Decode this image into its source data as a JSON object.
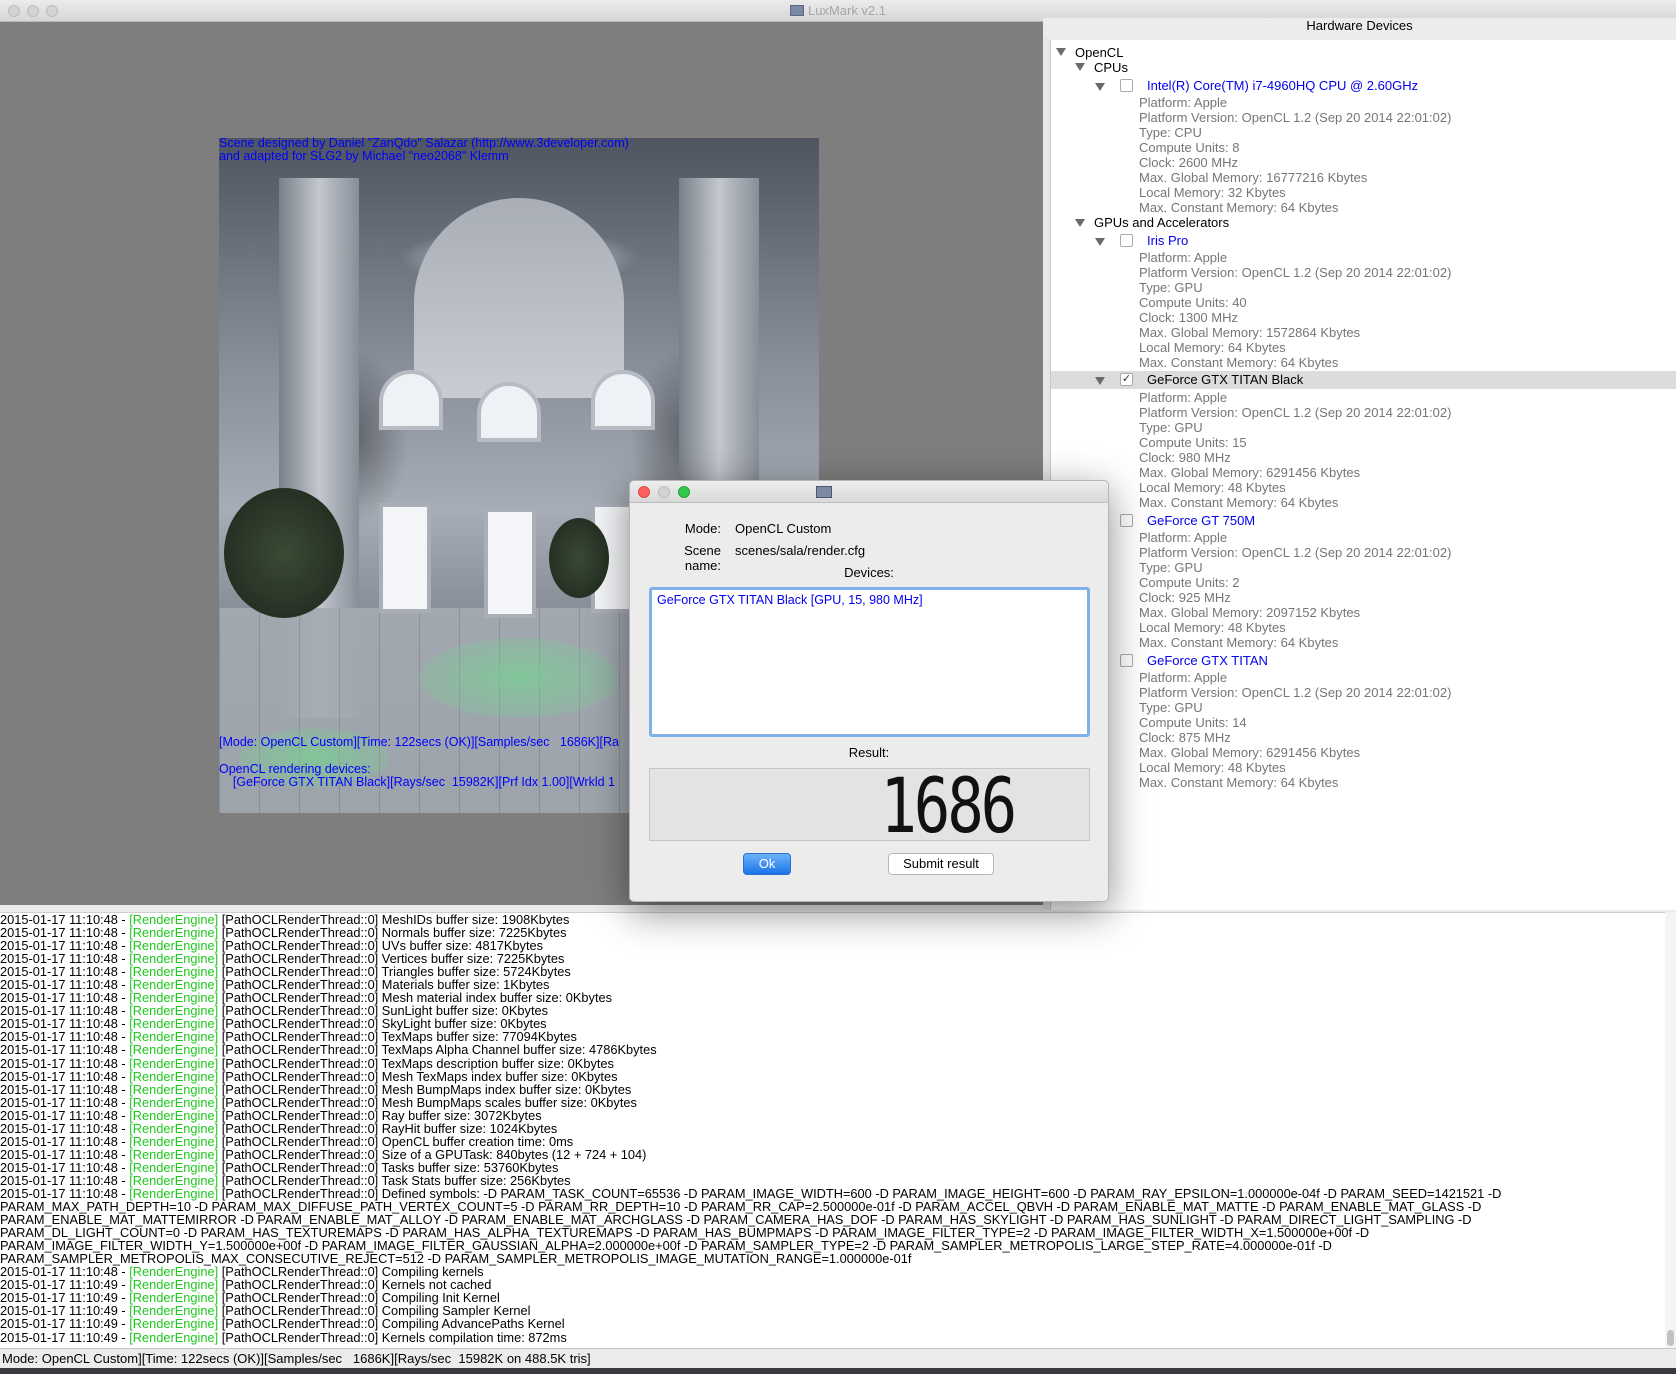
{
  "window": {
    "title": "LuxMark v2.1"
  },
  "render": {
    "credit_line1": "Scene designed by Daniel \"ZanQdo\" Salazar (http://www.3developer.com)",
    "credit_line2": "and adapted for SLG2 by Michael \"neo2068\" Klemm",
    "stats_line": "[Mode: OpenCL Custom][Time: 122secs (OK)][Samples/sec   1686K][Ra",
    "devices_label": "OpenCL rendering devices:",
    "device_line": "    [GeForce GTX TITAN Black][Rays/sec  15982K][Prf Idx 1.00][Wrkld 1"
  },
  "hardware": {
    "header": "Hardware Devices",
    "root": "OpenCL",
    "cpus_label": "CPUs",
    "gpus_label": "GPUs and Accelerators",
    "cpu": {
      "name": "Intel(R) Core(TM) i7-4960HQ CPU @ 2.60GHz",
      "props": [
        "Platform: Apple",
        "Platform Version: OpenCL 1.2 (Sep 20 2014 22:01:02)",
        "Type: CPU",
        "Compute Units: 8",
        "Clock: 2600 MHz",
        "Max. Global Memory: 16777216 Kbytes",
        "Local Memory: 32 Kbytes",
        "Max. Constant Memory: 64 Kbytes"
      ]
    },
    "gpu1": {
      "name": "Iris Pro",
      "props": [
        "Platform: Apple",
        "Platform Version: OpenCL 1.2 (Sep 20 2014 22:01:02)",
        "Type: GPU",
        "Compute Units: 40",
        "Clock: 1300 MHz",
        "Max. Global Memory: 1572864 Kbytes",
        "Local Memory: 64 Kbytes",
        "Max. Constant Memory: 64 Kbytes"
      ]
    },
    "gpu2": {
      "name": "GeForce GTX TITAN Black",
      "check": "✓",
      "props": [
        "Platform: Apple",
        "Platform Version: OpenCL 1.2 (Sep 20 2014 22:01:02)",
        "Type: GPU",
        "Compute Units: 15",
        "Clock: 980 MHz",
        "Max. Global Memory: 6291456 Kbytes",
        "Local Memory: 48 Kbytes",
        "Max. Constant Memory: 64 Kbytes"
      ]
    },
    "gpu3": {
      "name": "GeForce GT 750M",
      "props": [
        "Platform: Apple",
        "Platform Version: OpenCL 1.2 (Sep 20 2014 22:01:02)",
        "Type: GPU",
        "Compute Units: 2",
        "Clock: 925 MHz",
        "Max. Global Memory: 2097152 Kbytes",
        "Local Memory: 48 Kbytes",
        "Max. Constant Memory: 64 Kbytes"
      ]
    },
    "gpu4": {
      "name": "GeForce GTX TITAN",
      "props": [
        "Platform: Apple",
        "Platform Version: OpenCL 1.2 (Sep 20 2014 22:01:02)",
        "Type: GPU",
        "Compute Units: 14",
        "Clock: 875 MHz",
        "Max. Global Memory: 6291456 Kbytes",
        "Local Memory: 48 Kbytes",
        "Max. Constant Memory: 64 Kbytes"
      ]
    }
  },
  "dialog": {
    "mode_label": "Mode:",
    "mode_value": "OpenCL Custom",
    "scene_label": "Scene name:",
    "scene_value": "scenes/sala/render.cfg",
    "devices_label": "Devices:",
    "device_entry": "GeForce GTX TITAN Black [GPU, 15, 980 MHz]",
    "result_label": "Result:",
    "result_value": "1686",
    "ok_label": "Ok",
    "submit_label": "Submit result"
  },
  "log": {
    "tag": "[RenderEngine]",
    "lines": [
      {
        "ts": "2015-01-17 11:10:48 - ",
        "tag": true,
        "msg": " [PathOCLRenderThread::0] MeshIDs buffer size: 1908Kbytes"
      },
      {
        "ts": "2015-01-17 11:10:48 - ",
        "tag": true,
        "msg": " [PathOCLRenderThread::0] Normals buffer size: 7225Kbytes"
      },
      {
        "ts": "2015-01-17 11:10:48 - ",
        "tag": true,
        "msg": " [PathOCLRenderThread::0] UVs buffer size: 4817Kbytes"
      },
      {
        "ts": "2015-01-17 11:10:48 - ",
        "tag": true,
        "msg": " [PathOCLRenderThread::0] Vertices buffer size: 7225Kbytes"
      },
      {
        "ts": "2015-01-17 11:10:48 - ",
        "tag": true,
        "msg": " [PathOCLRenderThread::0] Triangles buffer size: 5724Kbytes"
      },
      {
        "ts": "2015-01-17 11:10:48 - ",
        "tag": true,
        "msg": " [PathOCLRenderThread::0] Materials buffer size: 1Kbytes"
      },
      {
        "ts": "2015-01-17 11:10:48 - ",
        "tag": true,
        "msg": " [PathOCLRenderThread::0] Mesh material index buffer size: 0Kbytes"
      },
      {
        "ts": "2015-01-17 11:10:48 - ",
        "tag": true,
        "msg": " [PathOCLRenderThread::0] SunLight buffer size: 0Kbytes"
      },
      {
        "ts": "2015-01-17 11:10:48 - ",
        "tag": true,
        "msg": " [PathOCLRenderThread::0] SkyLight buffer size: 0Kbytes"
      },
      {
        "ts": "2015-01-17 11:10:48 - ",
        "tag": true,
        "msg": " [PathOCLRenderThread::0] TexMaps buffer size: 77094Kbytes"
      },
      {
        "ts": "2015-01-17 11:10:48 - ",
        "tag": true,
        "msg": " [PathOCLRenderThread::0] TexMaps Alpha Channel buffer size: 4786Kbytes"
      },
      {
        "ts": "2015-01-17 11:10:48 - ",
        "tag": true,
        "msg": " [PathOCLRenderThread::0] TexMaps description buffer size: 0Kbytes"
      },
      {
        "ts": "2015-01-17 11:10:48 - ",
        "tag": true,
        "msg": " [PathOCLRenderThread::0] Mesh TexMaps index buffer size: 0Kbytes"
      },
      {
        "ts": "2015-01-17 11:10:48 - ",
        "tag": true,
        "msg": " [PathOCLRenderThread::0] Mesh BumpMaps index buffer size: 0Kbytes"
      },
      {
        "ts": "2015-01-17 11:10:48 - ",
        "tag": true,
        "msg": " [PathOCLRenderThread::0] Mesh BumpMaps scales buffer size: 0Kbytes"
      },
      {
        "ts": "2015-01-17 11:10:48 - ",
        "tag": true,
        "msg": " [PathOCLRenderThread::0] Ray buffer size: 3072Kbytes"
      },
      {
        "ts": "2015-01-17 11:10:48 - ",
        "tag": true,
        "msg": " [PathOCLRenderThread::0] RayHit buffer size: 1024Kbytes"
      },
      {
        "ts": "2015-01-17 11:10:48 - ",
        "tag": true,
        "msg": " [PathOCLRenderThread::0] OpenCL buffer creation time: 0ms"
      },
      {
        "ts": "2015-01-17 11:10:48 - ",
        "tag": true,
        "msg": " [PathOCLRenderThread::0] Size of a GPUTask: 840bytes (12 + 724 + 104)"
      },
      {
        "ts": "2015-01-17 11:10:48 - ",
        "tag": true,
        "msg": " [PathOCLRenderThread::0] Tasks buffer size: 53760Kbytes"
      },
      {
        "ts": "2015-01-17 11:10:48 - ",
        "tag": true,
        "msg": " [PathOCLRenderThread::0] Task Stats buffer size: 256Kbytes"
      },
      {
        "ts": "2015-01-17 11:10:48 - ",
        "tag": true,
        "msg": " [PathOCLRenderThread::0] Defined symbols: -D PARAM_TASK_COUNT=65536 -D PARAM_IMAGE_WIDTH=600 -D PARAM_IMAGE_HEIGHT=600 -D PARAM_RAY_EPSILON=1.000000e-04f -D PARAM_SEED=1421521 -D"
      },
      {
        "ts": "",
        "tag": false,
        "msg": "PARAM_MAX_PATH_DEPTH=10 -D PARAM_MAX_DIFFUSE_PATH_VERTEX_COUNT=5 -D PARAM_RR_DEPTH=10 -D PARAM_RR_CAP=2.500000e-01f -D PARAM_ACCEL_QBVH -D PARAM_ENABLE_MAT_MATTE -D PARAM_ENABLE_MAT_GLASS -D"
      },
      {
        "ts": "",
        "tag": false,
        "msg": "PARAM_ENABLE_MAT_MATTEMIRROR -D PARAM_ENABLE_MAT_ALLOY -D PARAM_ENABLE_MAT_ARCHGLASS -D PARAM_CAMERA_HAS_DOF -D PARAM_HAS_SKYLIGHT -D PARAM_HAS_SUNLIGHT -D PARAM_DIRECT_LIGHT_SAMPLING -D"
      },
      {
        "ts": "",
        "tag": false,
        "msg": "PARAM_DL_LIGHT_COUNT=0 -D PARAM_HAS_TEXTUREMAPS -D PARAM_HAS_ALPHA_TEXTUREMAPS -D PARAM_HAS_BUMPMAPS -D PARAM_IMAGE_FILTER_TYPE=2 -D PARAM_IMAGE_FILTER_WIDTH_X=1.500000e+00f -D"
      },
      {
        "ts": "",
        "tag": false,
        "msg": "PARAM_IMAGE_FILTER_WIDTH_Y=1.500000e+00f -D PARAM_IMAGE_FILTER_GAUSSIAN_ALPHA=2.000000e+00f -D PARAM_SAMPLER_TYPE=2 -D PARAM_SAMPLER_METROPOLIS_LARGE_STEP_RATE=4.000000e-01f -D"
      },
      {
        "ts": "",
        "tag": false,
        "msg": "PARAM_SAMPLER_METROPOLIS_MAX_CONSECUTIVE_REJECT=512 -D PARAM_SAMPLER_METROPOLIS_IMAGE_MUTATION_RANGE=1.000000e-01f"
      },
      {
        "ts": "2015-01-17 11:10:48 - ",
        "tag": true,
        "msg": " [PathOCLRenderThread::0] Compiling kernels"
      },
      {
        "ts": "2015-01-17 11:10:49 - ",
        "tag": true,
        "msg": " [PathOCLRenderThread::0] Kernels not cached"
      },
      {
        "ts": "2015-01-17 11:10:49 - ",
        "tag": true,
        "msg": " [PathOCLRenderThread::0] Compiling Init Kernel"
      },
      {
        "ts": "2015-01-17 11:10:49 - ",
        "tag": true,
        "msg": " [PathOCLRenderThread::0] Compiling Sampler Kernel"
      },
      {
        "ts": "2015-01-17 11:10:49 - ",
        "tag": true,
        "msg": " [PathOCLRenderThread::0] Compiling AdvancePaths Kernel"
      },
      {
        "ts": "2015-01-17 11:10:49 - ",
        "tag": true,
        "msg": " [PathOCLRenderThread::0] Kernels compilation time: 872ms"
      }
    ]
  },
  "status": {
    "text": "Mode: OpenCL Custom][Time: 122secs (OK)][Samples/sec   1686K][Rays/sec  15982K on 488.5K tris]"
  }
}
